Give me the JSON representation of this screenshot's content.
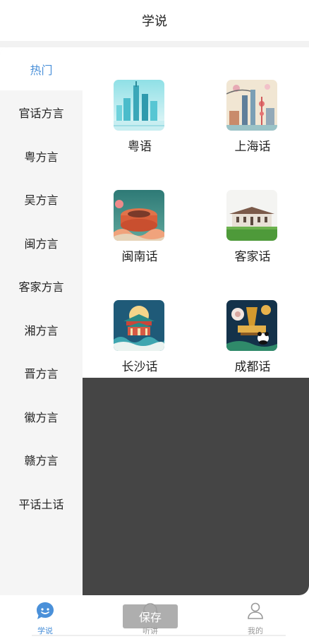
{
  "header": {
    "title": "学说"
  },
  "sidebar": {
    "items": [
      {
        "label": "热门",
        "active": true
      },
      {
        "label": "官话方言"
      },
      {
        "label": "粤方言"
      },
      {
        "label": "吴方言"
      },
      {
        "label": "闽方言"
      },
      {
        "label": "客家方言"
      },
      {
        "label": "湘方言"
      },
      {
        "label": "晋方言"
      },
      {
        "label": "徽方言"
      },
      {
        "label": "赣方言"
      },
      {
        "label": "平话土话"
      }
    ]
  },
  "dialects": [
    {
      "label": "粤语",
      "icon": "guangzhou-skyline-image"
    },
    {
      "label": "上海话",
      "icon": "shanghai-skyline-image"
    },
    {
      "label": "闽南话",
      "icon": "tulou-image"
    },
    {
      "label": "客家话",
      "icon": "hakka-house-image"
    },
    {
      "label": "长沙话",
      "icon": "changsha-pavilion-image"
    },
    {
      "label": "成都话",
      "icon": "chengdu-panda-image"
    }
  ],
  "tabbar": {
    "tabs": [
      {
        "label": "学说",
        "icon": "chat-bubble-icon",
        "active": true
      },
      {
        "label": "听讲",
        "icon": "headphones-icon"
      },
      {
        "label": "我的",
        "icon": "user-icon"
      }
    ]
  },
  "toast": {
    "text": "保存"
  },
  "colors": {
    "accent": "#4a90d9",
    "sidebar_bg": "#f5f5f5",
    "overlay": "#454545"
  }
}
